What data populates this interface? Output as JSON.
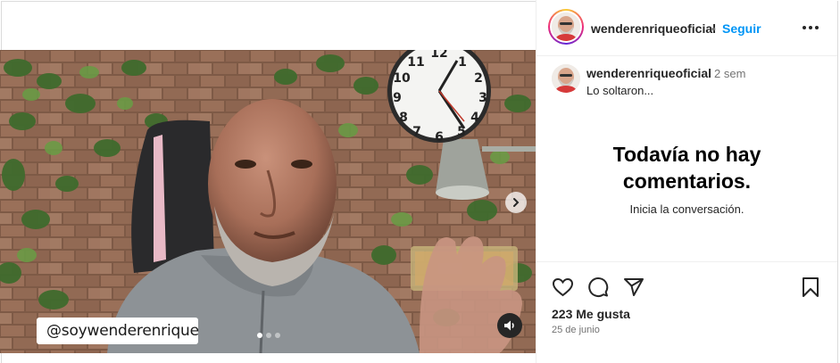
{
  "post": {
    "watermark": "@soywenderenrique",
    "carousel": {
      "slides": 3,
      "active_index": 0
    }
  },
  "header": {
    "username": "wenderenriqueoficial",
    "separator": "•",
    "follow_label": "Seguir",
    "more_icon": "more-horizontal-icon"
  },
  "caption": {
    "username": "wenderenriqueoficial",
    "time": "2 sem",
    "text": "Lo soltaron..."
  },
  "comments": {
    "empty_title_line1": "Todavía no hay",
    "empty_title_line2": "comentarios.",
    "empty_subtitle": "Inicia la conversación."
  },
  "actions": {
    "icons": [
      "heart-icon",
      "comment-icon",
      "share-icon",
      "bookmark-icon"
    ],
    "likes": "223 Me gusta",
    "date": "25 de junio"
  },
  "colors": {
    "link_blue": "#0095f6",
    "text": "#262626",
    "muted": "#737373",
    "border": "#dbdbdb"
  }
}
